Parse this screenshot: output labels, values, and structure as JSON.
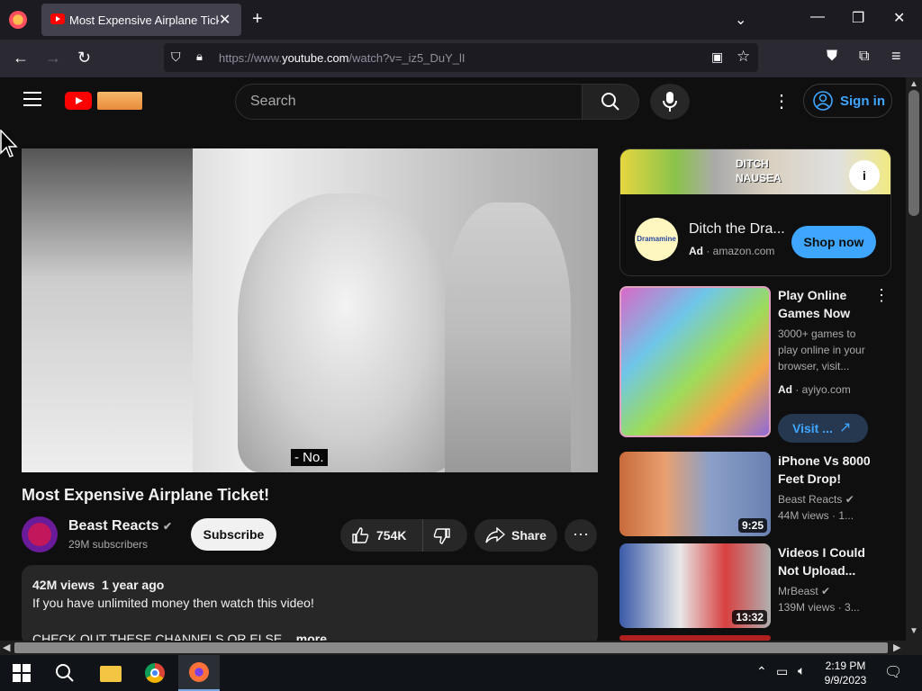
{
  "browser": {
    "tab_title": "Most Expensive Airplane Ticket!",
    "url_prefix": "https://www.",
    "url_domain": "youtube.com",
    "url_path": "/watch?v=_iz5_DuY_lI"
  },
  "youtube": {
    "search_placeholder": "Search",
    "sign_in_label": "Sign in"
  },
  "video": {
    "caption": "- No.",
    "title": "Most Expensive Airplane Ticket!",
    "channel_name": "Beast Reacts",
    "subscribers": "29M subscribers",
    "subscribe_label": "Subscribe",
    "likes": "754K",
    "share_label": "Share",
    "views": "42M views",
    "age": "1 year ago",
    "desc_line1": "If you have unlimited money then watch this video!",
    "desc_line2": "CHECK OUT THESE CHANNELS OR ELSE",
    "more_label": "...more"
  },
  "sidebar": {
    "ad_title": "Ditch the Dra...",
    "ad_label": "Ad",
    "ad_domain": "amazon.com",
    "ad_logo_text": "Dramamine",
    "ad_banner_text": "DITCH NAUSEA",
    "shop_now_label": "Shop now",
    "promo": {
      "title": "Play Online Games Now",
      "desc": "3000+ games to play online in your browser, visit...",
      "ad_label": "Ad",
      "domain": "ayiyo.com",
      "visit_label": "Visit ..."
    },
    "videos": [
      {
        "title": "iPhone Vs 8000 Feet Drop!",
        "channel": "Beast Reacts",
        "meta": "44M views · 1...",
        "duration": "9:25"
      },
      {
        "title": "Videos I Could Not Upload...",
        "channel": "MrBeast",
        "meta": "139M views · 3...",
        "duration": "13:32"
      }
    ]
  },
  "taskbar": {
    "time": "2:19 PM",
    "date": "9/9/2023"
  },
  "colors": {
    "accent_blue": "#3ea6ff",
    "youtube_red": "#ff0000",
    "background": "#0f0f0f"
  }
}
